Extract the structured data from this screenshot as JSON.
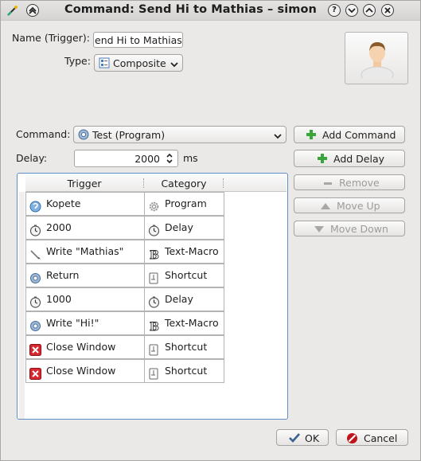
{
  "window": {
    "title": "Command: Send Hi to Mathias – simon"
  },
  "form": {
    "name_label": "Name (Trigger):",
    "name_value": "end Hi to Mathias",
    "type_label": "Type:",
    "type_value": "Composite",
    "command_label": "Command:",
    "command_value": "Test (Program)",
    "delay_label": "Delay:",
    "delay_value": "2000",
    "delay_unit": "ms"
  },
  "buttons": {
    "add_command": "Add Command",
    "add_delay": "Add Delay",
    "remove": "Remove",
    "move_up": "Move Up",
    "move_down": "Move Down",
    "ok": "OK",
    "cancel": "Cancel"
  },
  "table": {
    "headers": [
      "Trigger",
      "Category"
    ],
    "rows": [
      {
        "trigger": "Kopete",
        "category": "Program",
        "trigger_icon": "kopete-icon",
        "category_icon": "gear-icon"
      },
      {
        "trigger": "2000",
        "category": "Delay",
        "trigger_icon": "clock-icon",
        "category_icon": "clock-icon"
      },
      {
        "trigger": "Write \"Mathias\"",
        "category": "Text-Macro",
        "trigger_icon": "pen-icon",
        "category_icon": "text-macro-icon"
      },
      {
        "trigger": "Return",
        "category": "Shortcut",
        "trigger_icon": "program-icon",
        "category_icon": "shortcut-icon"
      },
      {
        "trigger": "1000",
        "category": "Delay",
        "trigger_icon": "clock-icon",
        "category_icon": "clock-icon"
      },
      {
        "trigger": "Write \"Hi!\"",
        "category": "Text-Macro",
        "trigger_icon": "program-icon",
        "category_icon": "text-macro-icon"
      },
      {
        "trigger": "Close Window",
        "category": "Shortcut",
        "trigger_icon": "close-window-icon",
        "category_icon": "shortcut-icon"
      },
      {
        "trigger": "Close Window",
        "category": "Shortcut",
        "trigger_icon": "close-window-icon",
        "category_icon": "shortcut-icon"
      }
    ]
  },
  "colors": {
    "accent": "#5e8fc6",
    "add_green": "#3aa53a",
    "cancel_red": "#c0141a"
  }
}
